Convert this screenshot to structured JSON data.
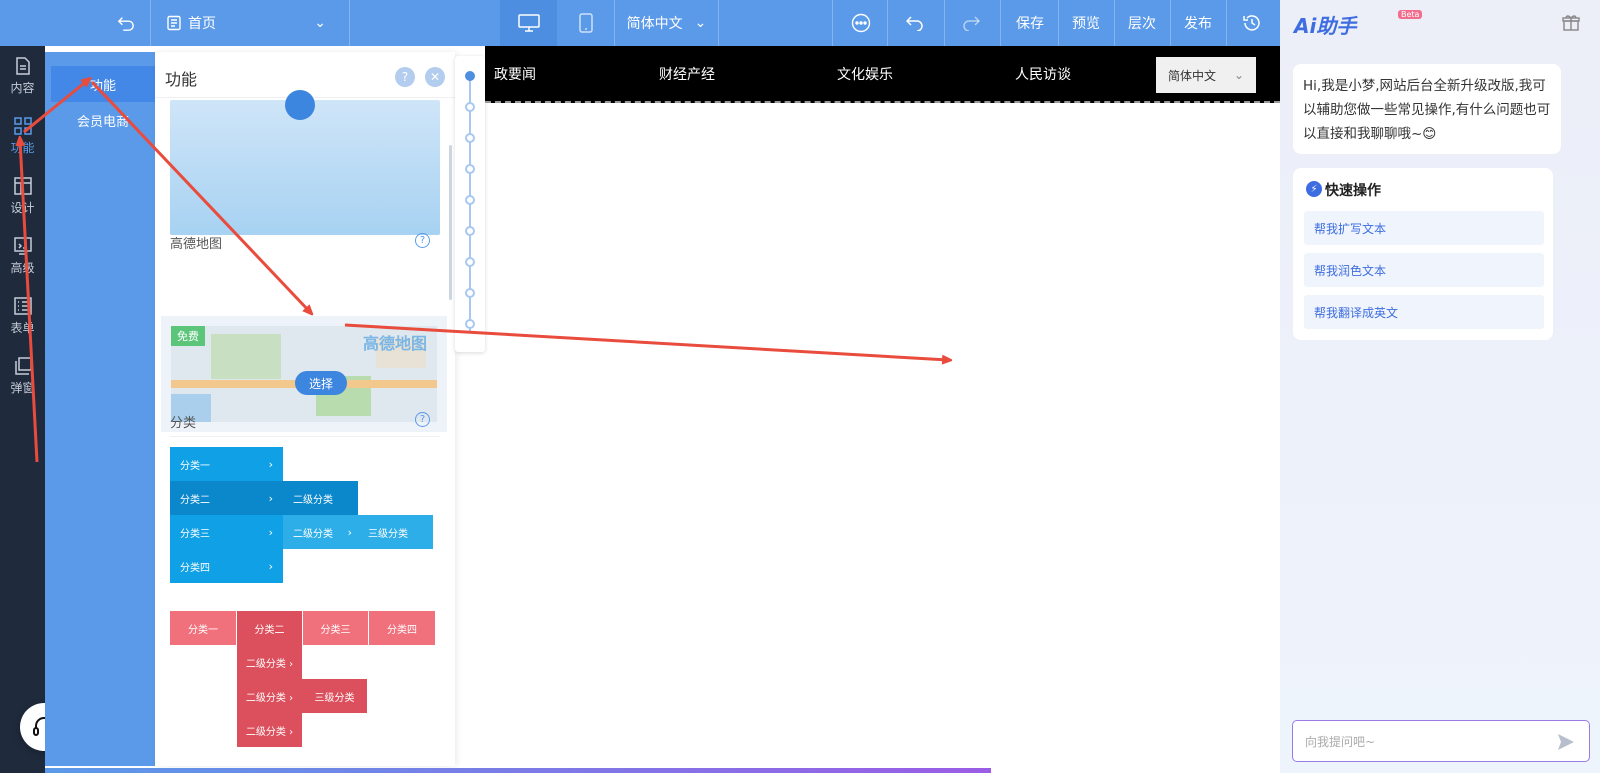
{
  "toolbar": {
    "page_select": "首页",
    "language": "简体中文",
    "save": "保存",
    "preview": "预览",
    "layers": "层次",
    "publish": "发布"
  },
  "rail": {
    "items": [
      "内容",
      "功能",
      "设计",
      "高级",
      "表单",
      "弹窗"
    ]
  },
  "subnav": {
    "items": [
      "功能",
      "会员电商"
    ]
  },
  "panel": {
    "title": "功能",
    "help_glyph": "?",
    "close_glyph": "✕",
    "map_section": "高德地图",
    "map_tag": "免费",
    "map_logo": "高德地图",
    "select_label": "选择",
    "category_section": "分类",
    "blue_categories": [
      "分类一",
      "分类二",
      "分类三",
      "分类四"
    ],
    "blue_sub": [
      "二级分类",
      "二级分类",
      "三级分类"
    ],
    "red_categories": [
      "分类一",
      "分类二",
      "分类三",
      "分类四"
    ],
    "red_sub": [
      "二级分类 ›",
      "二级分类 ›",
      "三级分类",
      "二级分类 ›"
    ]
  },
  "site": {
    "nav": [
      "政要闻",
      "财经产经",
      "文化娱乐",
      "人民访谈"
    ],
    "language": "简体中文"
  },
  "ai": {
    "logo": "Ai助手",
    "beta": "Beta",
    "greeting": "Hi,我是小梦,网站后台全新升级改版,我可以辅助您做一些常见操作,有什么问题也可以直接和我聊聊哦~😊",
    "quick_title": "快速操作",
    "quick_icon_glyph": "⚡",
    "quick_actions": [
      "帮我扩写文本",
      "帮我润色文本",
      "帮我翻译成英文"
    ],
    "input_placeholder": "向我提问吧~"
  },
  "colors": {
    "toolbar_blue": "#5b9ae8",
    "rail_dark": "#1f2a3c",
    "annotation_red": "#e94b3c",
    "ai_accent": "#3d6de0"
  }
}
